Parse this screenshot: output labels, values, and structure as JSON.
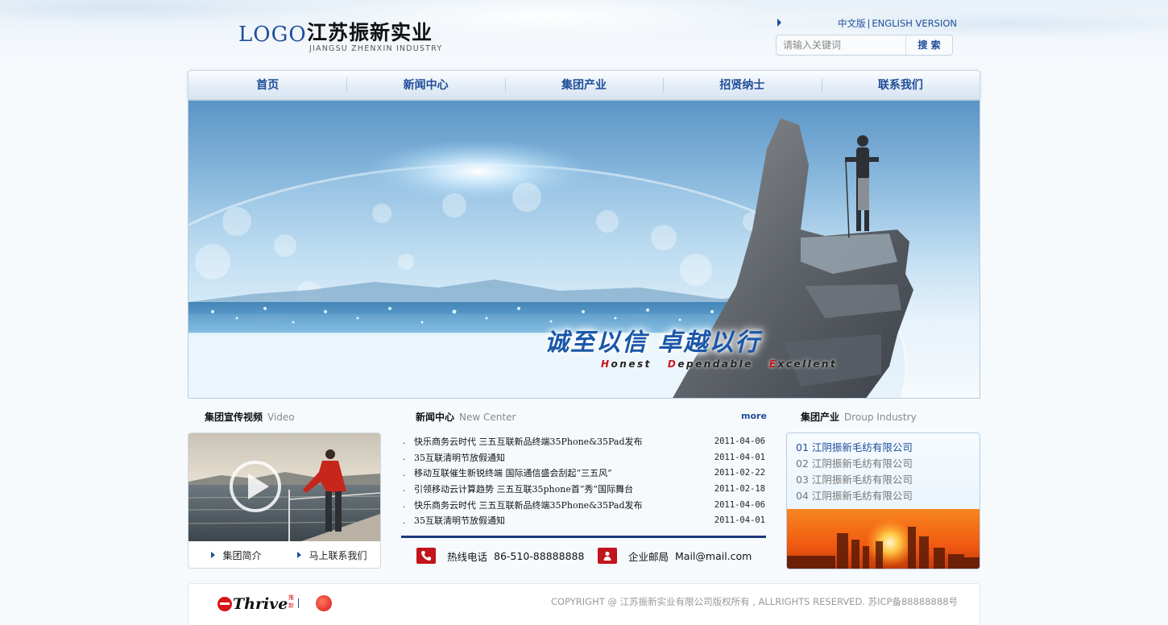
{
  "header": {
    "logo_text": "LOGO",
    "brand_cn": "江苏振新实业",
    "brand_en": "JIANGSU ZHENXIN INDUSTRY",
    "lang_cn": "中文版",
    "lang_sep": "|",
    "lang_en": "ENGLISH VERSION",
    "search_placeholder": "请输入关键词",
    "search_button": "搜 索"
  },
  "nav": {
    "items": [
      "首页",
      "新闻中心",
      "集团产业",
      "招贤纳士",
      "联系我们"
    ]
  },
  "banner": {
    "slogan_cn": "诚至以信  卓越以行",
    "slogan_en_parts": [
      {
        "cap": "H",
        "rest": "onest"
      },
      {
        "cap": "D",
        "rest": "ependable"
      },
      {
        "cap": "E",
        "rest": "xcellent"
      }
    ]
  },
  "video": {
    "title_cn": "集团宣传视频",
    "title_en": "Video",
    "links": [
      "集团简介",
      "马上联系我们"
    ]
  },
  "news": {
    "title_cn": "新闻中心",
    "title_en": "New Center",
    "more": "more",
    "bullet": ".",
    "items": [
      {
        "text": "快乐商务云时代 三五互联新品终端35Phone&35Pad发布",
        "date": "2011-04-06"
      },
      {
        "text": "35互联清明节放假通知",
        "date": "2011-04-01"
      },
      {
        "text": "移动互联催生新锐终端  国际通信盛会刮起“三五风”",
        "date": "2011-02-22"
      },
      {
        "text": "引领移动云计算趋势   三五互联35phone首“秀”国际舞台",
        "date": "2011-02-18"
      },
      {
        "text": "快乐商务云时代 三五互联新品终端35Phone&35Pad发布",
        "date": "2011-04-06"
      },
      {
        "text": "35互联清明节放假通知",
        "date": "2011-04-01"
      }
    ],
    "hotline_label": "热线电话",
    "hotline_value": "86-510-88888888",
    "mail_label": "企业邮局",
    "mail_value": "Mail@mail.com"
  },
  "industry": {
    "title_cn": "集团产业",
    "title_en": "Droup Industry",
    "items": [
      "01 江阴振新毛纺有限公司",
      "02 江阴振新毛纺有限公司",
      "03 江阴振新毛纺有限公司",
      "04 江阴振新毛纺有限公司"
    ],
    "active_index": 0
  },
  "footer": {
    "thrive_text": "Thrive",
    "thrive_sup": "推新",
    "copyright": "COPYRIGHT @ 江苏振新实业有限公司版权所有 , ALLRIGHTS RESERVED.   苏ICP备88888888号"
  },
  "colors": {
    "brand_blue": "#1f4d98",
    "accent_red": "#c1141b",
    "rule_navy": "#1a3a78"
  },
  "icons": [
    "triangle-arrow-icon",
    "play-icon",
    "phone-icon",
    "user-mail-icon",
    "thrive-logo-icon",
    "badge-icon"
  ]
}
